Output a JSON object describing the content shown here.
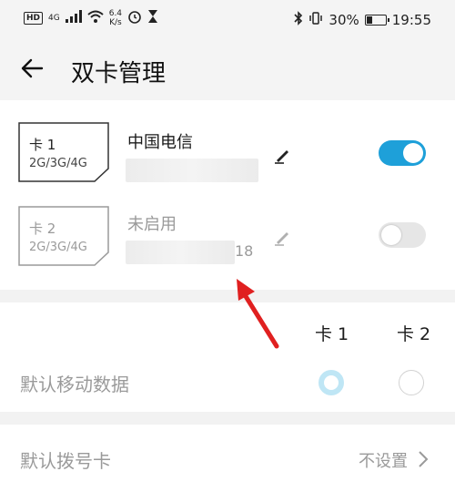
{
  "status_bar": {
    "hd": "HD",
    "signal": "4G",
    "speed_value": "6.4",
    "speed_unit": "K/s",
    "battery": "30%",
    "time": "19:55"
  },
  "header": {
    "title": "双卡管理"
  },
  "sims": [
    {
      "name": "卡 1",
      "network": "2G/3G/4G",
      "carrier": "中国电信",
      "number_tail": "",
      "enabled": true
    },
    {
      "name": "卡 2",
      "network": "2G/3G/4G",
      "carrier": "未启用",
      "number_tail": "18",
      "enabled": false
    }
  ],
  "defaults": {
    "col1": "卡 1",
    "col2": "卡 2",
    "mobile_data_label": "默认移动数据",
    "mobile_data_selected": "卡 1"
  },
  "dial": {
    "label": "默认拨号卡",
    "value": "不设置"
  },
  "colors": {
    "accent": "#1ea0d9",
    "annotation_arrow": "#e02020"
  }
}
